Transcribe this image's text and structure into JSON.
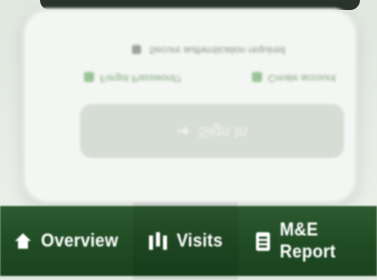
{
  "login": {
    "hint_text": "Secure authentication required",
    "forgot_password": "Forgot Password?",
    "create_account": "Create account",
    "sign_in": "Sign In"
  },
  "bottom_nav": {
    "items": [
      {
        "label": "Overview",
        "icon": "home-icon"
      },
      {
        "label": "Visits",
        "icon": "map-icon"
      },
      {
        "label": "M&E Report",
        "icon": "clipboard-icon"
      }
    ]
  },
  "colors": {
    "nav_bg": "#1f4b23",
    "nav_text": "#ffffff",
    "card_bg": "#f4f6f3",
    "page_bg": "#e6ece5"
  }
}
